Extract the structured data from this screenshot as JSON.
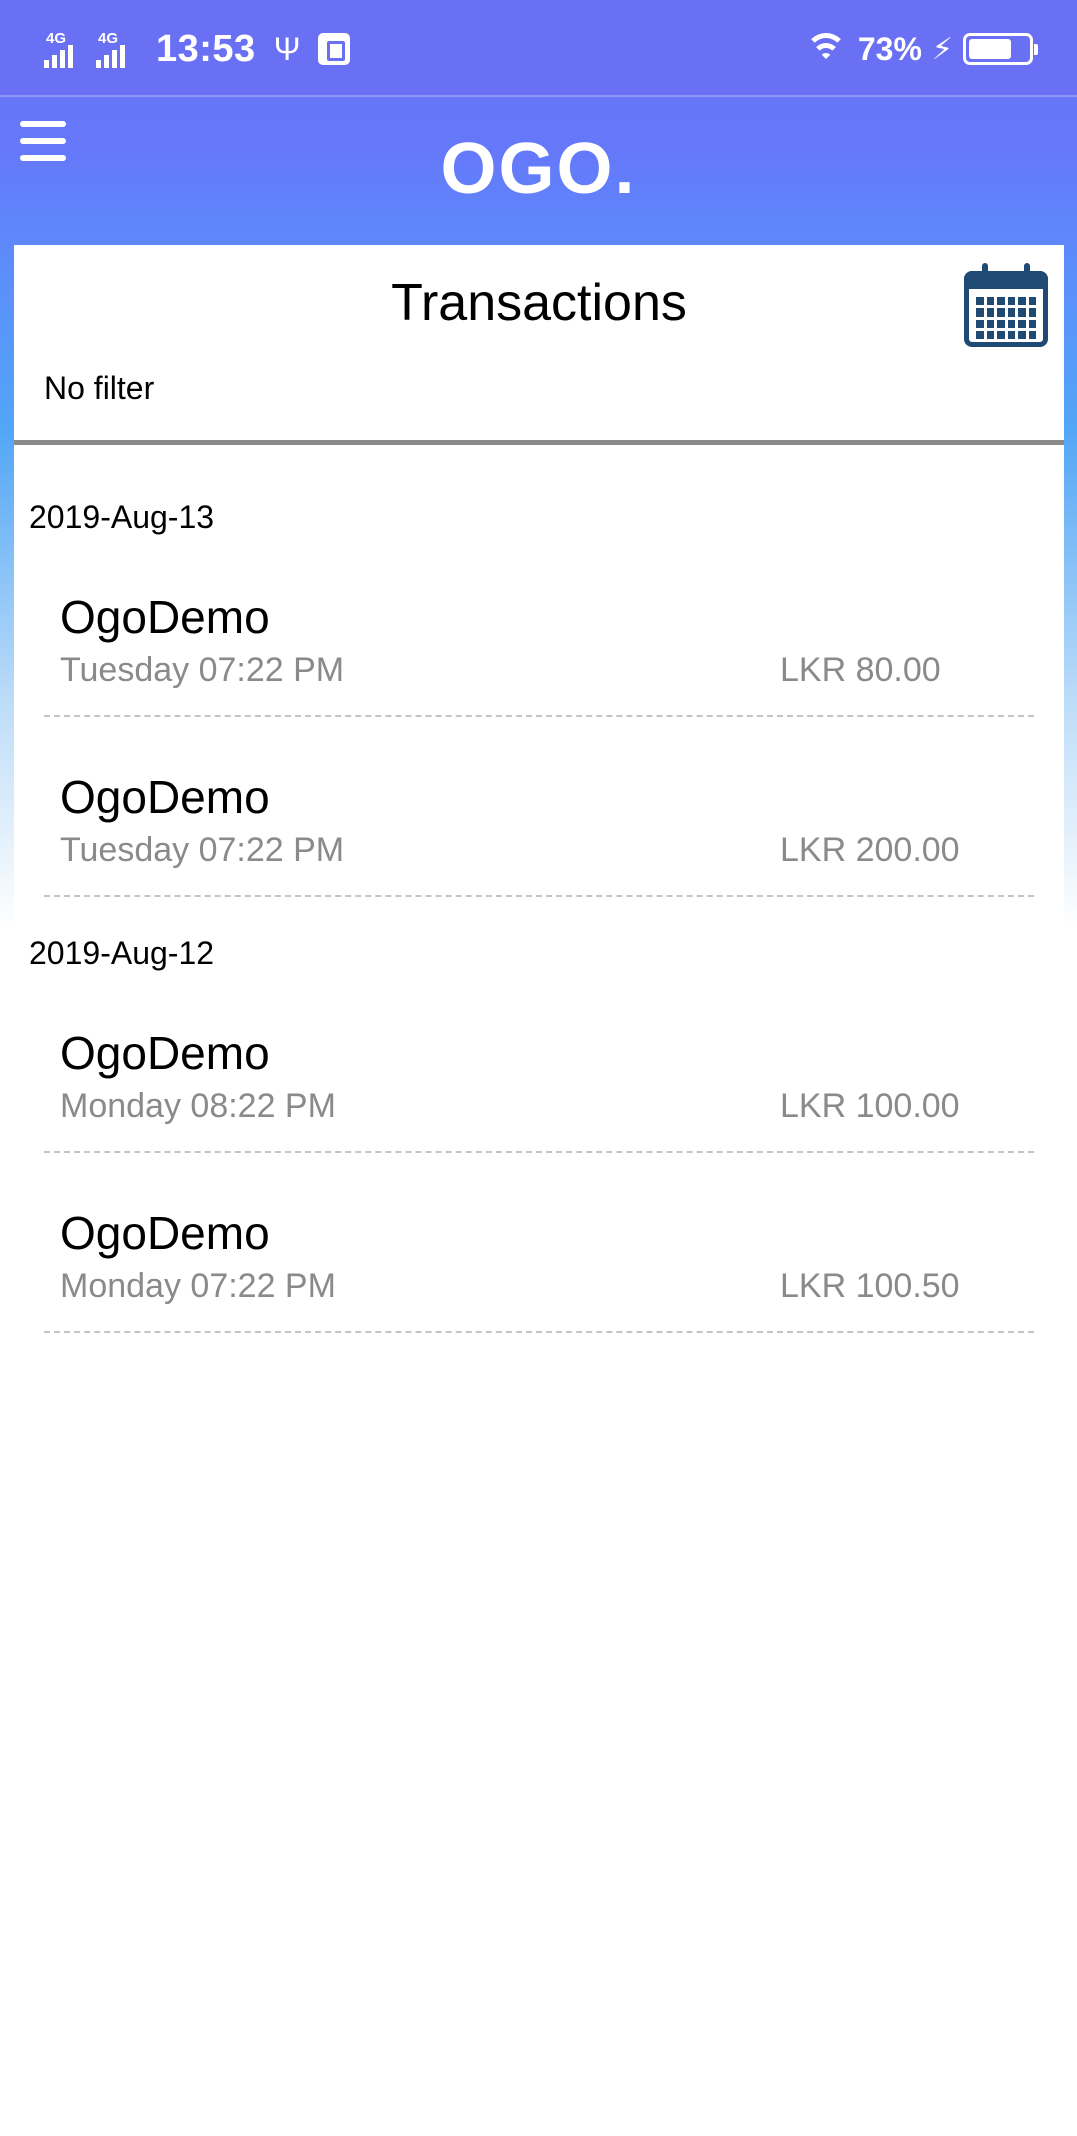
{
  "status_bar": {
    "network_1": "4G",
    "network_2": "4G",
    "time": "13:53",
    "battery_percent": "73%",
    "battery_level": 0.73,
    "icons": [
      "signal-icon",
      "usb-icon",
      "usb-debug-icon",
      "wifi-icon",
      "charging-icon",
      "battery-icon"
    ]
  },
  "header": {
    "logo": "OGO.",
    "menu_icon": "hamburger-menu-icon"
  },
  "page": {
    "title": "Transactions",
    "filter_label": "No filter",
    "calendar_icon": "calendar-icon"
  },
  "groups": [
    {
      "date": "2019-Aug-13",
      "transactions": [
        {
          "merchant": "OgoDemo",
          "time": "Tuesday 07:22 PM",
          "amount": "LKR 80.00"
        },
        {
          "merchant": "OgoDemo",
          "time": "Tuesday 07:22 PM",
          "amount": "LKR 200.00"
        }
      ]
    },
    {
      "date": "2019-Aug-12",
      "transactions": [
        {
          "merchant": "OgoDemo",
          "time": "Monday 08:22 PM",
          "amount": "LKR 100.00"
        },
        {
          "merchant": "OgoDemo",
          "time": "Monday 07:22 PM",
          "amount": "LKR 100.50"
        }
      ]
    }
  ],
  "colors": {
    "header_blue": "#6a70f4",
    "calendar_navy": "#1e4a73",
    "secondary_text": "#8a8a8a"
  }
}
